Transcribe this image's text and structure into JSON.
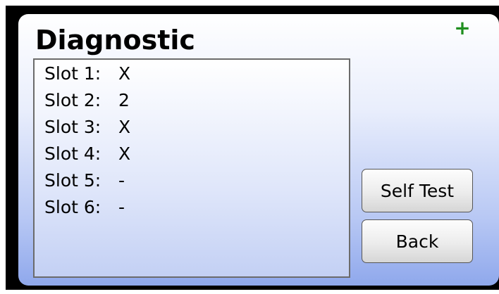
{
  "screen": {
    "title": "Diagnostic",
    "status_icon": "plus-icon",
    "status_symbol": "+",
    "status_color": "#1f8f1f"
  },
  "slots": [
    {
      "label": "Slot 1:",
      "value": "X"
    },
    {
      "label": "Slot 2:",
      "value": "2"
    },
    {
      "label": "Slot 3:",
      "value": "X"
    },
    {
      "label": "Slot 4:",
      "value": "X"
    },
    {
      "label": "Slot 5:",
      "value": "-"
    },
    {
      "label": "Slot 6:",
      "value": "-"
    }
  ],
  "buttons": {
    "self_test_label": "Self Test",
    "back_label": "Back"
  }
}
